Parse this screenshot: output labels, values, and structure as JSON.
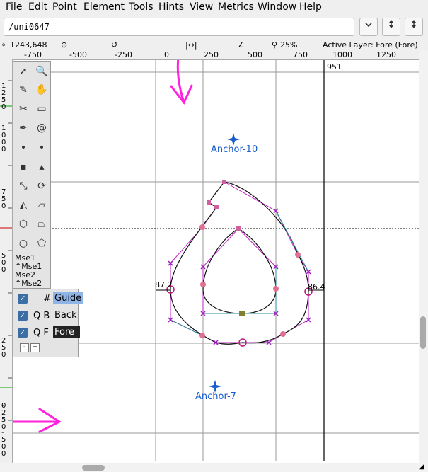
{
  "menu": {
    "items": [
      {
        "label": "File",
        "u": "F",
        "rest": "ile"
      },
      {
        "label": "Edit",
        "u": "E",
        "rest": "dit"
      },
      {
        "label": "Point",
        "u": "P",
        "rest": "oint"
      },
      {
        "label": "Element",
        "u": "E",
        "rest": "lement"
      },
      {
        "label": "Tools",
        "u": "T",
        "rest": "ools"
      },
      {
        "label": "Hints",
        "u": "H",
        "rest": "ints"
      },
      {
        "label": "View",
        "u": "V",
        "rest": "iew"
      },
      {
        "label": "Metrics",
        "u": "M",
        "rest": "etrics"
      },
      {
        "label": "Window",
        "u": "W",
        "rest": "indow"
      },
      {
        "label": "Help",
        "u": "H",
        "rest": "elp"
      }
    ]
  },
  "toolbar": {
    "glyph_name": "/uni0647",
    "dropdown_icon": "chevron-down-icon",
    "prev_icon": "updown-arrow-icon",
    "next_icon": "updown-arrow-icon"
  },
  "status": {
    "coords": "1243,648",
    "zoom": "25%",
    "active_layer": "Active Layer: Fore (Fore)"
  },
  "ruler": {
    "ticks": [
      "-750",
      "-500",
      "-250",
      "0",
      "250",
      "500",
      "750",
      "1000",
      "1250"
    ],
    "vticks": [
      "1\n2\n5\n0",
      "1\n0\n0\n0",
      "7\n5\n0",
      "5\n0\n0",
      "2\n5\n0",
      "0",
      "-\n2\n5\n0",
      "-\n5\n0\n0"
    ]
  },
  "canvas": {
    "width_label": "951",
    "anchor_top": "Anchor-10",
    "anchor_bottom": "Anchor-7",
    "left_measure": "87.2",
    "right_measure": "86.4"
  },
  "tools": {
    "mse_lines": [
      "Mse1",
      "^Mse1",
      "Mse2",
      "^Mse2"
    ]
  },
  "layers": {
    "rows": [
      {
        "flags": "#",
        "name": "Guide",
        "selected": "guide"
      },
      {
        "flags": "Q B",
        "name": "Back",
        "selected": "none"
      },
      {
        "flags": "Q F",
        "name": "Fore",
        "selected": "fore"
      }
    ],
    "minus": "-",
    "plus": "+"
  },
  "colors": {
    "accent_guide": "#8fb4e6",
    "fore_bg": "#222222",
    "outline_magenta": "#c020c0",
    "anchor_blue": "#1a5ecc",
    "annotation_pink": "#ff22dd"
  }
}
